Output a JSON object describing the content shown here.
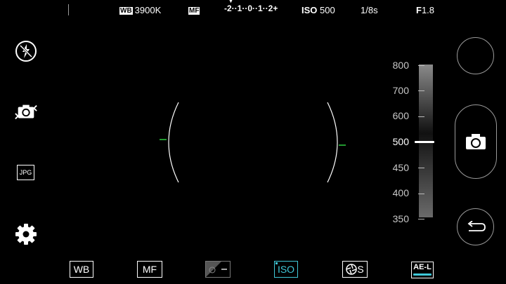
{
  "topbar": {
    "wb_tag": "WB",
    "wb_value": "3900K",
    "mf_tag": "MF",
    "ev_scale": "-2··1··0··1··2+",
    "iso_label": "ISO",
    "iso_value": "500",
    "shutter": "1/8s",
    "aperture_f": "F",
    "aperture_value": "1.8"
  },
  "left_controls": {
    "flash": "flash-off-icon",
    "camera_switch": "camera-switch-icon",
    "format_label": "JPG",
    "settings": "gear-icon"
  },
  "iso_scale": {
    "labels": [
      "800",
      "700",
      "600",
      "500",
      "450",
      "400",
      "350"
    ],
    "selected": "500"
  },
  "bottom_bar": {
    "wb": "WB",
    "mf": "MF",
    "iso": "ISO",
    "shutter_speed": "S",
    "ael": "AE-L"
  },
  "colors": {
    "accent": "#3fc8d8",
    "focus_marker": "#2ecc40",
    "background": "#000000"
  }
}
